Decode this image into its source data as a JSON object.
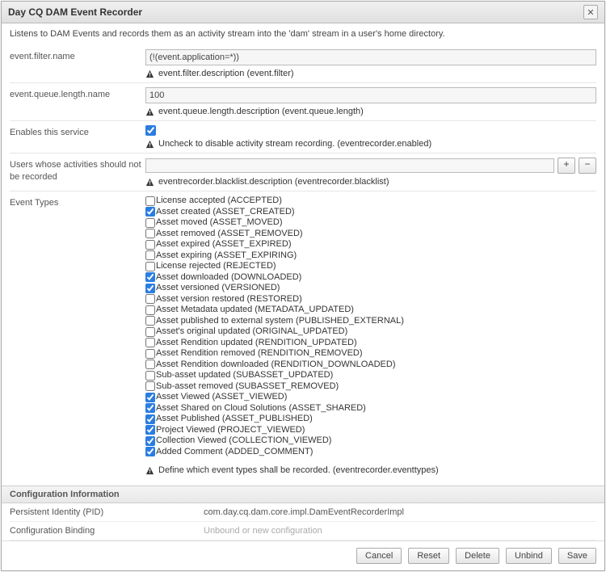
{
  "title": "Day CQ DAM Event Recorder",
  "description": "Listens to DAM Events and records them as an activity stream into the 'dam' stream in a user's home directory.",
  "fields": {
    "event_filter": {
      "label": "event.filter.name",
      "value": "(!(event.application=*))",
      "hint": "event.filter.description (event.filter)"
    },
    "event_queue_length": {
      "label": "event.queue.length.name",
      "value": "100",
      "hint": "event.queue.length.description (event.queue.length)"
    },
    "enabled": {
      "label": "Enables this service",
      "checked": true,
      "hint": "Uncheck to disable activity stream recording. (eventrecorder.enabled)"
    },
    "blacklist": {
      "label": "Users whose activities should not be recorded",
      "hint": "eventrecorder.blacklist.description (eventrecorder.blacklist)"
    },
    "event_types": {
      "label": "Event Types",
      "hint": "Define which event types shall be recorded. (eventrecorder.eventtypes)",
      "options": [
        {
          "label": "License accepted (ACCEPTED)",
          "checked": false
        },
        {
          "label": "Asset created (ASSET_CREATED)",
          "checked": true
        },
        {
          "label": "Asset moved (ASSET_MOVED)",
          "checked": false
        },
        {
          "label": "Asset removed (ASSET_REMOVED)",
          "checked": false
        },
        {
          "label": "Asset expired (ASSET_EXPIRED)",
          "checked": false
        },
        {
          "label": "Asset expiring (ASSET_EXPIRING)",
          "checked": false
        },
        {
          "label": "License rejected (REJECTED)",
          "checked": false
        },
        {
          "label": "Asset downloaded (DOWNLOADED)",
          "checked": true
        },
        {
          "label": "Asset versioned (VERSIONED)",
          "checked": true
        },
        {
          "label": "Asset version restored (RESTORED)",
          "checked": false
        },
        {
          "label": "Asset Metadata updated (METADATA_UPDATED)",
          "checked": false
        },
        {
          "label": "Asset published to external system (PUBLISHED_EXTERNAL)",
          "checked": false
        },
        {
          "label": "Asset's original updated (ORIGINAL_UPDATED)",
          "checked": false
        },
        {
          "label": "Asset Rendition updated (RENDITION_UPDATED)",
          "checked": false
        },
        {
          "label": "Asset Rendition removed (RENDITION_REMOVED)",
          "checked": false
        },
        {
          "label": "Asset Rendition downloaded (RENDITION_DOWNLOADED)",
          "checked": false
        },
        {
          "label": "Sub-asset updated (SUBASSET_UPDATED)",
          "checked": false
        },
        {
          "label": "Sub-asset removed (SUBASSET_REMOVED)",
          "checked": false
        },
        {
          "label": "Asset Viewed (ASSET_VIEWED)",
          "checked": true
        },
        {
          "label": "Asset Shared on Cloud Solutions (ASSET_SHARED)",
          "checked": true
        },
        {
          "label": "Asset Published (ASSET_PUBLISHED)",
          "checked": true
        },
        {
          "label": "Project Viewed (PROJECT_VIEWED)",
          "checked": true
        },
        {
          "label": "Collection Viewed (COLLECTION_VIEWED)",
          "checked": true
        },
        {
          "label": "Added Comment (ADDED_COMMENT)",
          "checked": true
        }
      ]
    }
  },
  "config_info": {
    "header": "Configuration Information",
    "pid_label": "Persistent Identity (PID)",
    "pid_value": "com.day.cq.dam.core.impl.DamEventRecorderImpl",
    "binding_label": "Configuration Binding",
    "binding_value": "Unbound or new configuration"
  },
  "buttons": {
    "cancel": "Cancel",
    "reset": "Reset",
    "delete": "Delete",
    "unbind": "Unbind",
    "save": "Save"
  }
}
